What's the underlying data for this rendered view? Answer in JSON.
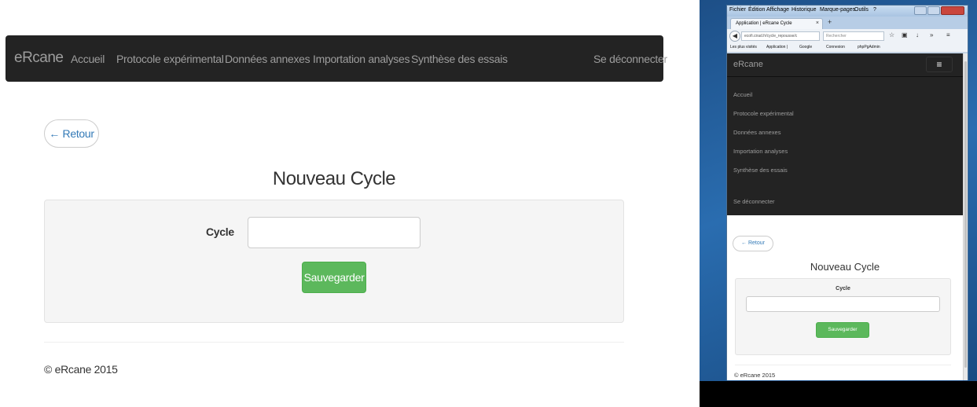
{
  "desktop": {
    "brand": "eRcane",
    "nav": [
      "Accueil",
      "Protocole expérimental",
      "Données annexes",
      "Importation analyses",
      "Synthèse des essais"
    ],
    "logout": "Se déconnecter",
    "back": "← Retour",
    "title": "Nouveau Cycle",
    "field_label": "Cycle",
    "field_value": "",
    "save": "Sauvegarder",
    "footer": "© eRcane 2015"
  },
  "mobile": {
    "menu": [
      "Fichier",
      "Édition",
      "Affichage",
      "Historique",
      "Marque-pages",
      "Outils",
      "?"
    ],
    "tab_title": "Application | eRcane Cycle",
    "url": "ecofi.cirad.fr/cycle_repousse/c",
    "search_placeholder": "Rechercher",
    "bookmarks": [
      "Les plus visités",
      "Application |",
      "Google",
      "Connexion",
      "phpPgAdmin"
    ],
    "brand": "eRcane",
    "nav": [
      "Accueil",
      "Protocole expérimental",
      "Données annexes",
      "Importation analyses",
      "Synthèse des essais"
    ],
    "logout": "Se déconnecter",
    "back": "← Retour",
    "title": "Nouveau Cycle",
    "field_label": "Cycle",
    "save": "Sauvegarder",
    "footer": "© eRcane 2015"
  },
  "colors": {
    "navbar": "#232323",
    "nav_text": "#9d9d9d",
    "link": "#337ab7",
    "success": "#5cb85c",
    "well": "#f5f5f5"
  }
}
